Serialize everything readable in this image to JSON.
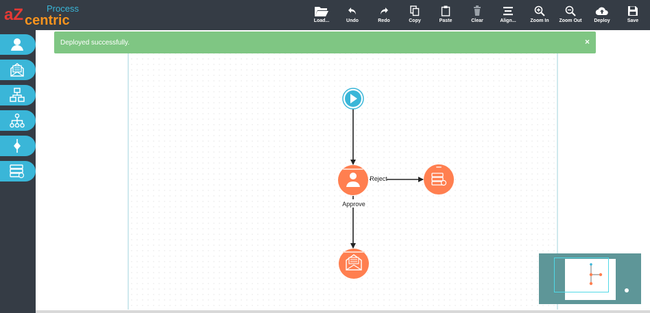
{
  "app": {
    "logo_prefix": "aZ",
    "logo_product": "Process",
    "logo_brand": "centric"
  },
  "toolbar": {
    "items": [
      {
        "label": "Load...",
        "icon": "folder-open-icon"
      },
      {
        "label": "Undo",
        "icon": "undo-icon"
      },
      {
        "label": "Redo",
        "icon": "redo-icon"
      },
      {
        "label": "Copy",
        "icon": "copy-icon"
      },
      {
        "label": "Paste",
        "icon": "paste-icon"
      },
      {
        "label": "Clear",
        "icon": "trash-icon"
      },
      {
        "label": "Align...",
        "icon": "align-icon"
      },
      {
        "label": "Zoom In",
        "icon": "zoom-in-icon"
      },
      {
        "label": "Zoom Out",
        "icon": "zoom-out-icon"
      },
      {
        "label": "Deploy",
        "icon": "cloud-upload-icon"
      },
      {
        "label": "Save",
        "icon": "floppy-disk-icon"
      }
    ]
  },
  "sidebar": {
    "items": [
      {
        "icon": "user-task-icon"
      },
      {
        "icon": "mail-task-icon"
      },
      {
        "icon": "hierarchy-icon"
      },
      {
        "icon": "org-chart-icon"
      },
      {
        "icon": "gateway-icon"
      },
      {
        "icon": "database-icon"
      }
    ]
  },
  "notification": {
    "message": "Deployed successfully.",
    "close": "×"
  },
  "flow": {
    "edges": [
      {
        "label": ""
      },
      {
        "label": "Reject"
      },
      {
        "label": "Approve"
      }
    ]
  },
  "colors": {
    "topbar": "#353c45",
    "accent": "#3ab6d8",
    "node": "#ff7f50",
    "success": "#7fc683",
    "logo_red": "#e53935",
    "logo_orange": "#f7931e"
  }
}
